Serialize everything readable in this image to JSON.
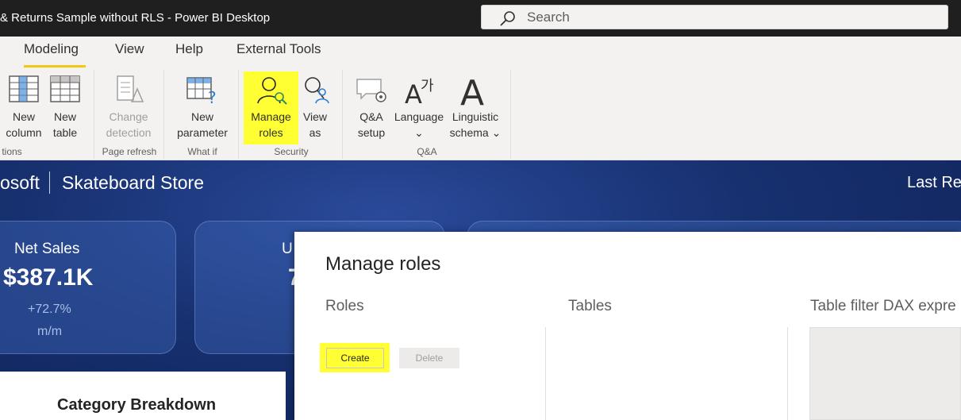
{
  "titlebar": {
    "title": "& Returns Sample without RLS - Power BI Desktop",
    "search_label": "Search"
  },
  "ribbon": {
    "tabs": [
      "Modeling",
      "View",
      "Help",
      "External Tools"
    ],
    "active_tab": "Modeling",
    "buttons": {
      "new_column": [
        "New",
        "column"
      ],
      "new_table": [
        "New",
        "table"
      ],
      "change_detection": [
        "Change",
        "detection"
      ],
      "new_parameter": [
        "New",
        "parameter"
      ],
      "manage_roles": [
        "Manage",
        "roles"
      ],
      "view_as": [
        "View",
        "as"
      ],
      "qa_setup": [
        "Q&A",
        "setup"
      ],
      "language": [
        "Language",
        "⌄"
      ],
      "linguistic_schema": [
        "Linguistic",
        "schema ⌄"
      ]
    },
    "groups": {
      "calculations": "tions",
      "page_refresh": "Page refresh",
      "what_if": "What if",
      "security": "Security",
      "qa": "Q&A"
    }
  },
  "report": {
    "brand_left": "osoft",
    "brand_name": "Skateboard Store",
    "last_refresh": "Last Re",
    "card1": {
      "title": "Net Sales",
      "value": "$387.1K",
      "change": "+72.7%",
      "period": "m/m"
    },
    "card2": {
      "title_partial": "U",
      "value_partial": "7"
    },
    "breakdown_title": "Category Breakdown"
  },
  "dialog": {
    "title": "Manage roles",
    "columns": {
      "roles": "Roles",
      "tables": "Tables",
      "filter": "Table filter DAX expre"
    },
    "create_label": "Create",
    "delete_label": "Delete"
  },
  "colors": {
    "highlight": "#ffff33",
    "accent": "#f2c811",
    "canvas": "#17306f"
  }
}
